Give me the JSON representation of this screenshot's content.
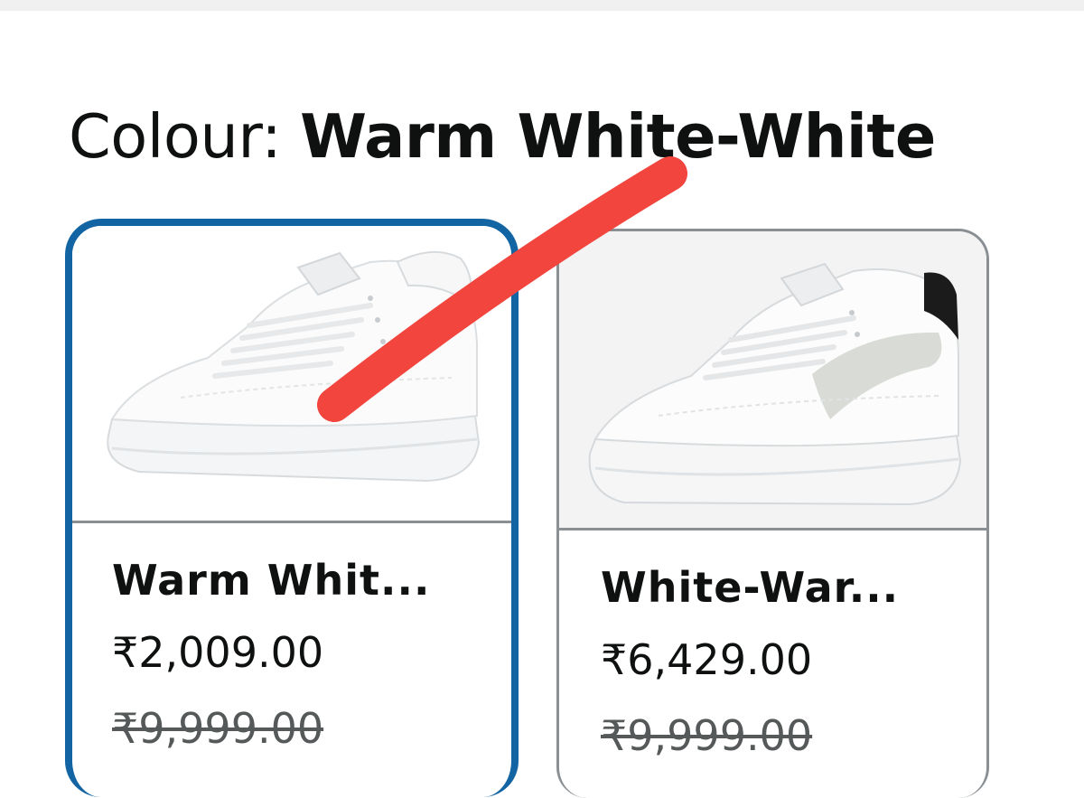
{
  "colour_selector": {
    "label": "Colour: ",
    "selected_value": "Warm White-White"
  },
  "swatches": [
    {
      "name": "Warm Whit...",
      "price": "₹2,009.00",
      "mrp": "₹9,999.00",
      "selected": true
    },
    {
      "name": "White-War...",
      "price": "₹6,429.00",
      "mrp": "₹9,999.00",
      "selected": false
    }
  ],
  "colors": {
    "selected_border": "#1264a3",
    "unselected_border": "#8a8f94",
    "annotation_stroke": "#f2453d",
    "text": "#0f1111",
    "mrp_text": "#565959"
  },
  "icons": {
    "swatch_1_image": "white-sneaker-image",
    "swatch_2_image": "white-sneaker-grey-stripe-image"
  }
}
